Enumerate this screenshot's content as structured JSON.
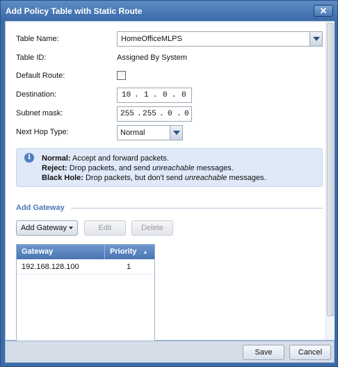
{
  "dialog": {
    "title": "Add Policy Table with Static Route",
    "close_label": "✕"
  },
  "form": {
    "table_name": {
      "label": "Table Name:",
      "value": "HomeOfficeMLPS"
    },
    "table_id": {
      "label": "Table ID:",
      "value": "Assigned By System"
    },
    "default_route": {
      "label": "Default Route:",
      "checked": false
    },
    "destination": {
      "label": "Destination:",
      "octets": [
        "10",
        "1",
        "0",
        "0"
      ],
      "dot": "."
    },
    "subnet_mask": {
      "label": "Subnet mask:",
      "octets": [
        "255",
        "255",
        "0",
        "0"
      ],
      "dot": "."
    },
    "next_hop_type": {
      "label": "Next Hop Type:",
      "value": "Normal"
    }
  },
  "info": {
    "icon": "info-icon",
    "normal": {
      "term": "Normal:",
      "text": " Accept and forward packets."
    },
    "reject": {
      "term": "Reject:",
      "text": " Drop packets, and send ",
      "em": "unreachable",
      "tail": " messages."
    },
    "black_hole": {
      "term": "Black Hole:",
      "text": " Drop packets, but don't send ",
      "em": "unreachable",
      "tail": " messages."
    }
  },
  "gateway_section": {
    "title": "Add Gateway",
    "add_button": "Add Gateway",
    "edit_button": "Edit",
    "delete_button": "Delete",
    "columns": {
      "gateway": "Gateway",
      "priority": "Priority"
    },
    "rows": [
      {
        "gateway": "192.168.128.100",
        "priority": "1"
      }
    ]
  },
  "footer": {
    "save": "Save",
    "cancel": "Cancel"
  },
  "colors": {
    "titlebar": "#3d6aa8",
    "section_title": "#4a78b5",
    "info_background": "#dfe9f7"
  }
}
